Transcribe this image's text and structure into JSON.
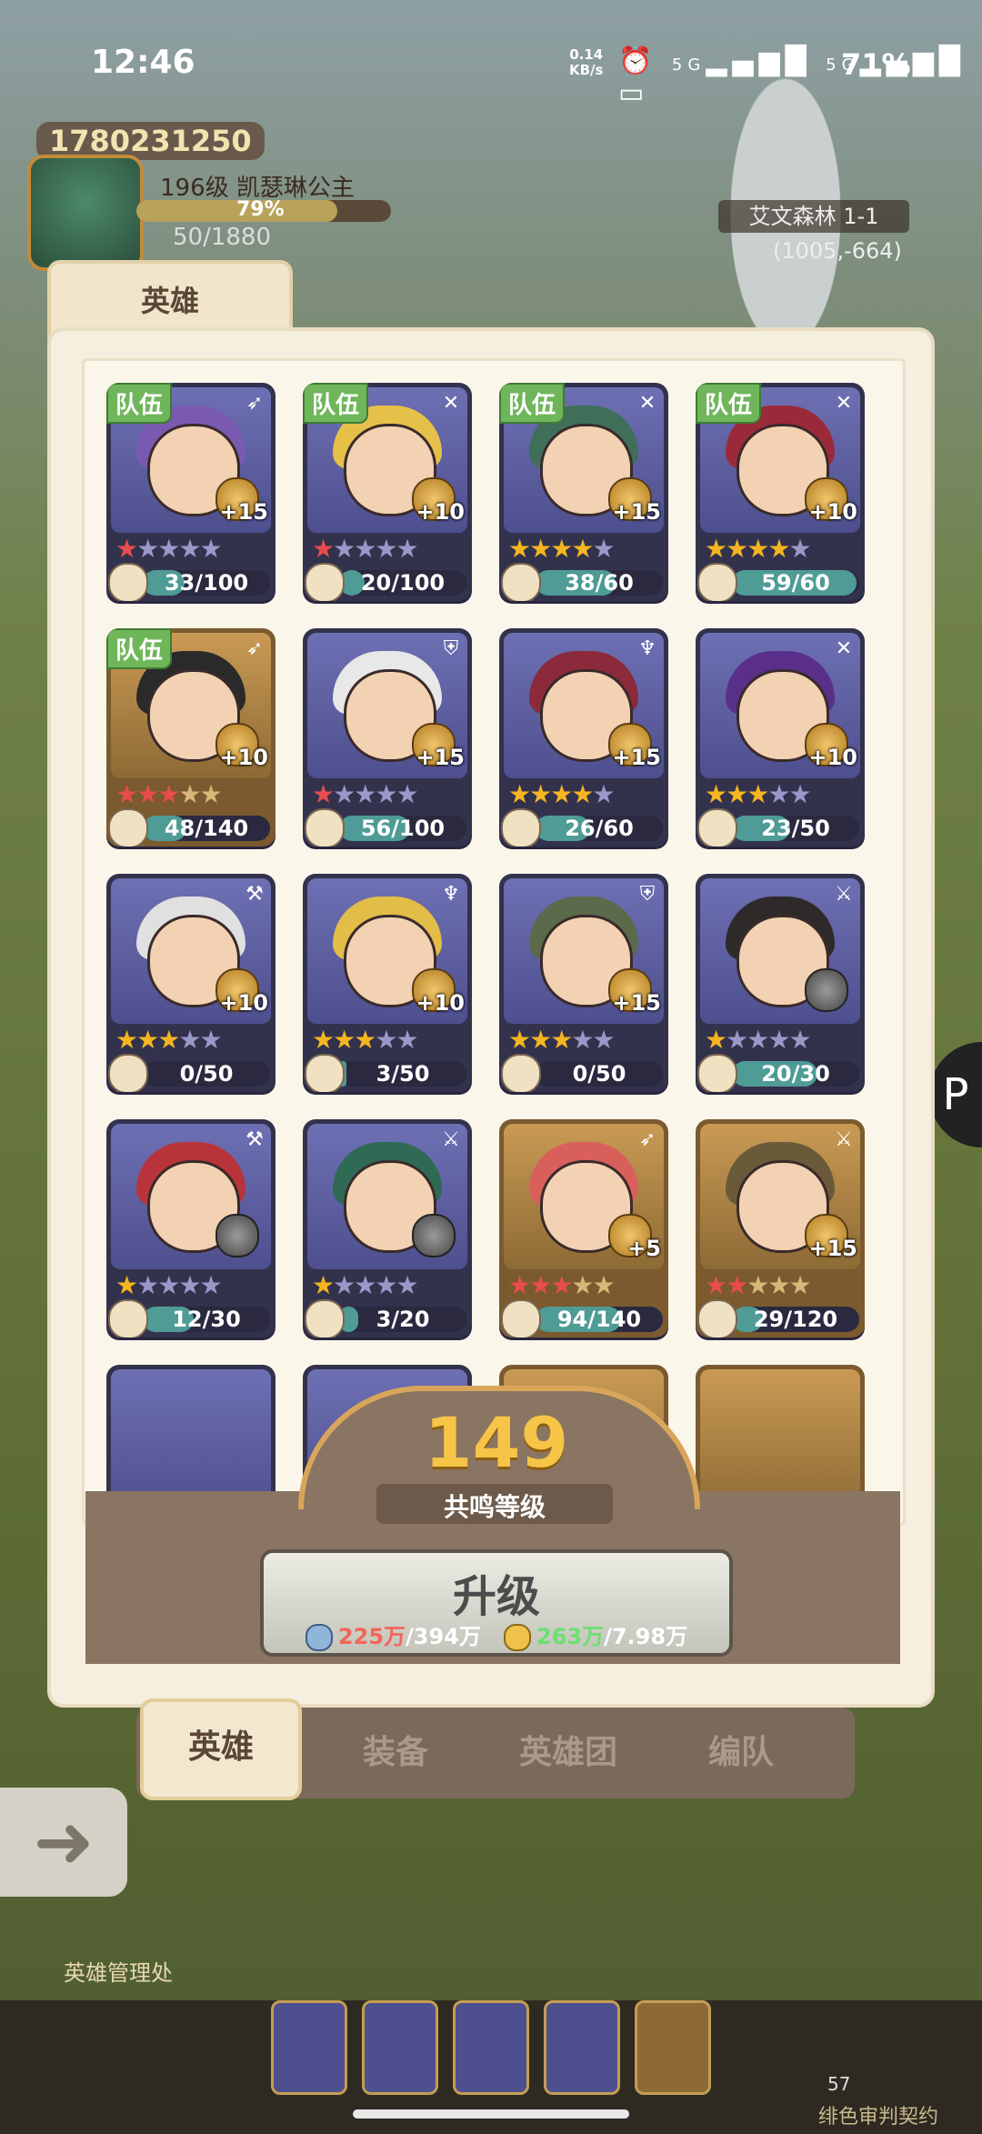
{
  "status_bar": {
    "time": "12:46",
    "net_speed": "0.14",
    "net_unit": "KB/s",
    "signal1": "5G",
    "signal2": "5G",
    "battery": "71%"
  },
  "player": {
    "id": "1780231250",
    "level_name": "196级  凯瑟琳公主",
    "xp_percent_text": "79%",
    "xp_fraction": 0.79,
    "energy": "50/1880"
  },
  "map": {
    "location": "艾文森林 1-1",
    "coords": "(1005,-664)",
    "building_label": "英雄管理处"
  },
  "panel": {
    "title": "英雄"
  },
  "team_label": "队伍",
  "heroes": [
    {
      "team": true,
      "stars": 1,
      "star_color": "red",
      "bonus": "+15",
      "frag": "33/100",
      "frag_ratio": 0.33,
      "hair": "#7a5ab0",
      "frame": "purple",
      "class_icon": "bow-icon"
    },
    {
      "team": true,
      "stars": 1,
      "star_color": "red",
      "bonus": "+10",
      "frag": "20/100",
      "frag_ratio": 0.2,
      "hair": "#e6c14a",
      "frame": "purple",
      "class_icon": "cross-icon"
    },
    {
      "team": true,
      "stars": 4,
      "star_color": "gold",
      "bonus": "+15",
      "frag": "38/60",
      "frag_ratio": 0.63,
      "hair": "#3f6f58",
      "frame": "purple",
      "class_icon": "cross-icon"
    },
    {
      "team": true,
      "stars": 4,
      "star_color": "gold",
      "bonus": "+10",
      "frag": "59/60",
      "frag_ratio": 0.98,
      "hair": "#9a2a3a",
      "frame": "purple",
      "class_icon": "cross-icon"
    },
    {
      "team": true,
      "stars": 3,
      "star_color": "red",
      "bonus": "+10",
      "frag": "48/140",
      "frag_ratio": 0.34,
      "hair": "#2a2a2a",
      "frame": "gold",
      "class_icon": "bow-icon"
    },
    {
      "team": false,
      "stars": 1,
      "star_color": "red",
      "bonus": "+15",
      "frag": "56/100",
      "frag_ratio": 0.56,
      "hair": "#e8e8e8",
      "frame": "purple",
      "class_icon": "shield-icon"
    },
    {
      "team": false,
      "stars": 4,
      "star_color": "gold",
      "bonus": "+15",
      "frag": "26/60",
      "frag_ratio": 0.43,
      "hair": "#8a2a3a",
      "frame": "purple",
      "class_icon": "staff-icon"
    },
    {
      "team": false,
      "stars": 3,
      "star_color": "gold",
      "bonus": "+10",
      "frag": "23/50",
      "frag_ratio": 0.46,
      "hair": "#5a2f8a",
      "frame": "purple",
      "class_icon": "cross-icon"
    },
    {
      "team": false,
      "stars": 3,
      "star_color": "gold",
      "bonus": "+10",
      "frag": "0/50",
      "frag_ratio": 0.0,
      "hair": "#e0e0e0",
      "frame": "purple",
      "class_icon": "axe-icon"
    },
    {
      "team": false,
      "stars": 3,
      "star_color": "gold",
      "bonus": "+10",
      "frag": "3/50",
      "frag_ratio": 0.06,
      "hair": "#e2bd48",
      "frame": "purple",
      "class_icon": "staff-icon"
    },
    {
      "team": false,
      "stars": 3,
      "star_color": "gold",
      "bonus": "+15",
      "frag": "0/50",
      "frag_ratio": 0.0,
      "hair": "#5b6a4a",
      "frame": "purple",
      "class_icon": "shield-icon"
    },
    {
      "team": false,
      "stars": 1,
      "star_color": "gold",
      "bonus": "",
      "frag": "20/30",
      "frag_ratio": 0.67,
      "hair": "#2f2a2a",
      "frame": "purple",
      "class_icon": "sword-icon"
    },
    {
      "team": false,
      "stars": 1,
      "star_color": "gold",
      "bonus": "",
      "frag": "12/30",
      "frag_ratio": 0.4,
      "hair": "#b8343a",
      "frame": "purple",
      "class_icon": "axe-icon"
    },
    {
      "team": false,
      "stars": 1,
      "star_color": "gold",
      "bonus": "",
      "frag": "3/20",
      "frag_ratio": 0.15,
      "hair": "#2f6a54",
      "frame": "purple",
      "class_icon": "sword-icon"
    },
    {
      "team": false,
      "stars": 3,
      "star_color": "red",
      "bonus": "+5",
      "frag": "94/140",
      "frag_ratio": 0.67,
      "hair": "#d9605a",
      "frame": "gold",
      "class_icon": "bow-icon"
    },
    {
      "team": false,
      "stars": 2,
      "star_color": "red",
      "bonus": "+15",
      "frag": "29/120",
      "frag_ratio": 0.24,
      "hair": "#6b5a3a",
      "frame": "gold",
      "class_icon": "sword-icon"
    }
  ],
  "resonance": {
    "level": "149",
    "label": "共鸣等级",
    "upgrade_label": "升级",
    "cost1_have": "225万",
    "cost1_need": "/394万",
    "cost2_have": "263万",
    "cost2_need": "/7.98万"
  },
  "tabs": [
    {
      "label": "英雄",
      "active": true
    },
    {
      "label": "装备",
      "active": false
    },
    {
      "label": "英雄团",
      "active": false
    },
    {
      "label": "编队",
      "active": false
    }
  ],
  "bottom": {
    "count": "57",
    "contract": "绯色审判契约"
  }
}
